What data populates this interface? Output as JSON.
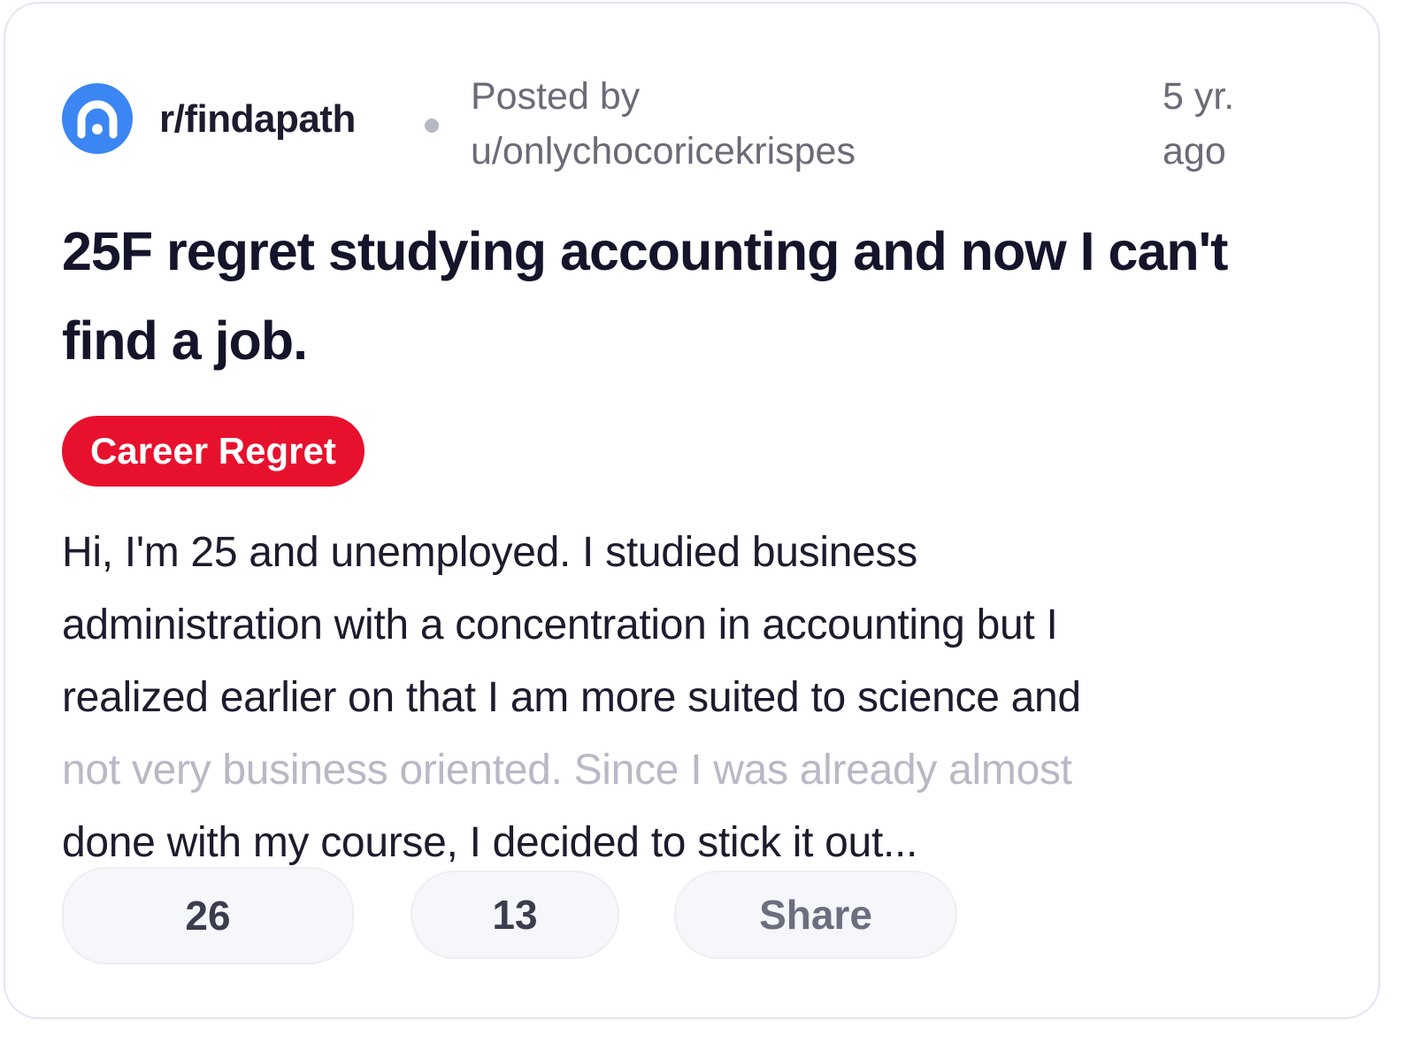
{
  "header": {
    "subreddit": "r/findapath",
    "posted_by_label": "Posted by",
    "author": "u/onlychocoricekrispes",
    "time_line1": "5 yr.",
    "time_line2": "ago",
    "icon": "subreddit-avatar-icon",
    "icon_color": "#3b86f2"
  },
  "post": {
    "title": "25F regret studying accounting and now I can't find a job.",
    "flair": "Career Regret",
    "flair_color": "#e8112d",
    "body_lines": [
      "Hi, I'm 25 and unemployed. I studied business",
      "administration with a concentration in accounting but I",
      "realized earlier on that I am more suited to science and",
      "not very business oriented. Since I was already almost",
      "done with my course, I decided to stick it out..."
    ]
  },
  "actions": {
    "upvotes": "26",
    "comments": "13",
    "share_label": "Share"
  }
}
